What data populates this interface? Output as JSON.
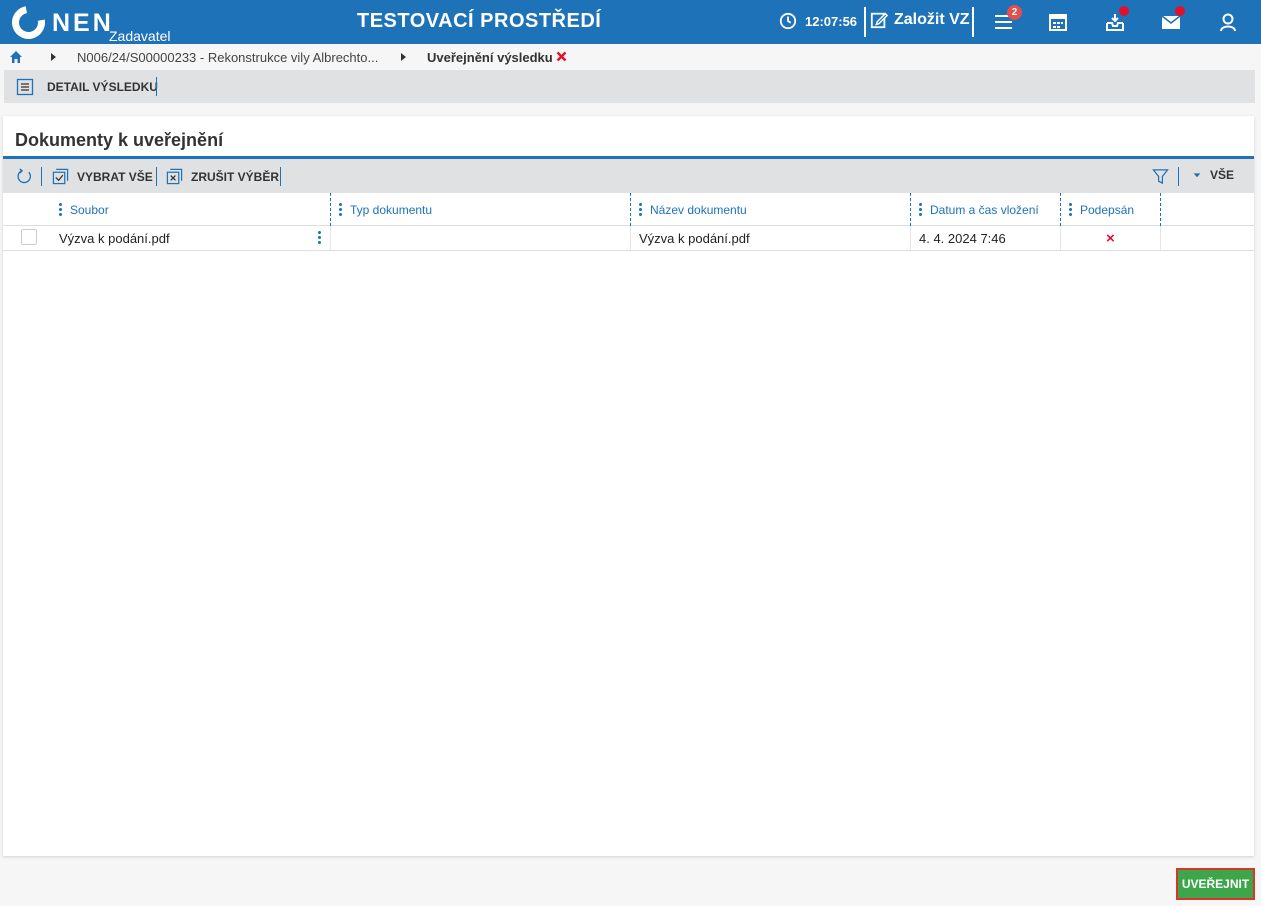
{
  "header": {
    "logo_text": "NEN",
    "logo_sub": "Zadavatel",
    "env_title": "TESTOVACÍ PROSTŘEDÍ",
    "time": "12:07:56",
    "create_label": "Založit VZ",
    "menu_badge": "2",
    "accent_color": "#1d72b8",
    "icons": [
      "clock-icon",
      "edit-icon",
      "menu-icon",
      "calendar-icon",
      "inbox-icon",
      "mail-icon",
      "user-icon"
    ]
  },
  "breadcrumb": {
    "items": [
      {
        "label": "N006/24/S00000233 - Rekonstrukce vily Albrechto..."
      },
      {
        "label": "Uveřejnění výsledku"
      }
    ]
  },
  "detail_toolbar": {
    "label": "DETAIL VÝSLEDKU"
  },
  "panel": {
    "title": "Dokumenty k uveřejnění",
    "toolbar": {
      "select_all": "VYBRAT VŠE",
      "cancel_selection": "ZRUŠIT VÝBĚR",
      "filter_value": "VŠE"
    },
    "columns": [
      "Soubor",
      "Typ dokumentu",
      "Název dokumentu",
      "Datum a čas vložení",
      "Podepsán"
    ],
    "rows": [
      {
        "file": "Výzva k podání.pdf",
        "type": "",
        "name": "Výzva k podání.pdf",
        "inserted": "4. 4. 2024 7:46",
        "signed": "×"
      }
    ]
  },
  "footer": {
    "publish_label": "UVEŘEJNIT",
    "publish_color": "#3da64b",
    "highlight_color": "#d9352b"
  }
}
